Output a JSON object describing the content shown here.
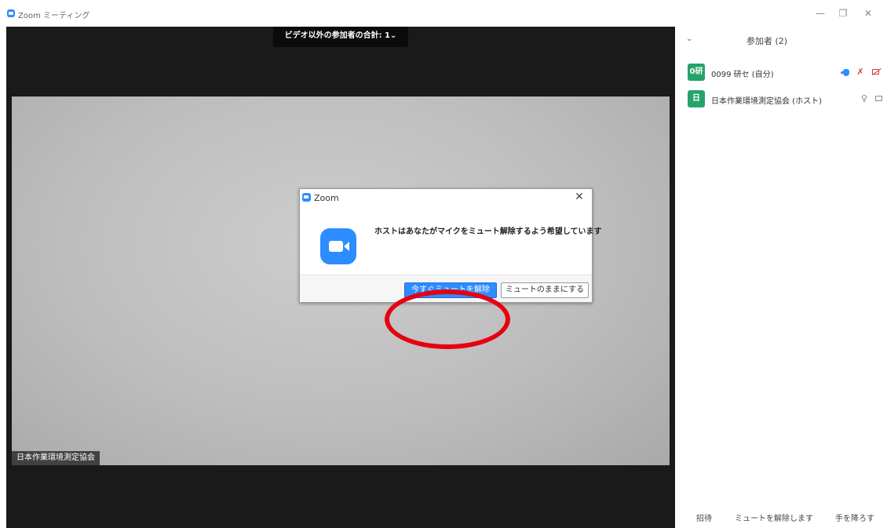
{
  "window": {
    "title": "Zoom ミーティング",
    "minimize": "—",
    "restore": "❐",
    "close": "✕"
  },
  "video": {
    "participants_banner": "ビデオ以外の参加者の合計: 1",
    "banner_chevron": "⌄",
    "speaker_name_tag": "日本作業環境測定協会"
  },
  "dialog": {
    "title": "Zoom",
    "close": "✕",
    "message": "ホストはあなたがマイクをミュート解除するよう希望しています",
    "unmute_now_button": "今すぐミュートを解除",
    "stay_muted_button": "ミュートのままにする"
  },
  "panel": {
    "collapse": "⌄",
    "title": "参加者 (2)",
    "participants": [
      {
        "avatar": "0研",
        "name": "0099 研セ (自分)",
        "hand_raised": true,
        "muted": true,
        "video_off": true
      },
      {
        "avatar": "日",
        "name": "日本作業環境測定協会 (ホスト)",
        "hand_raised": false,
        "muted": false,
        "video_off": false
      }
    ],
    "footer": {
      "invite": "招待",
      "unmute_all": "ミュートを解除します",
      "lower_hand": "手を降ろす"
    }
  },
  "icons": {
    "mic_muted": "🎙",
    "mic": "🎙"
  },
  "colors": {
    "brand_blue": "#2d8cff",
    "avatar_green": "#26a36b",
    "muted_red": "#e0353f",
    "annotation_red": "#e60012"
  }
}
